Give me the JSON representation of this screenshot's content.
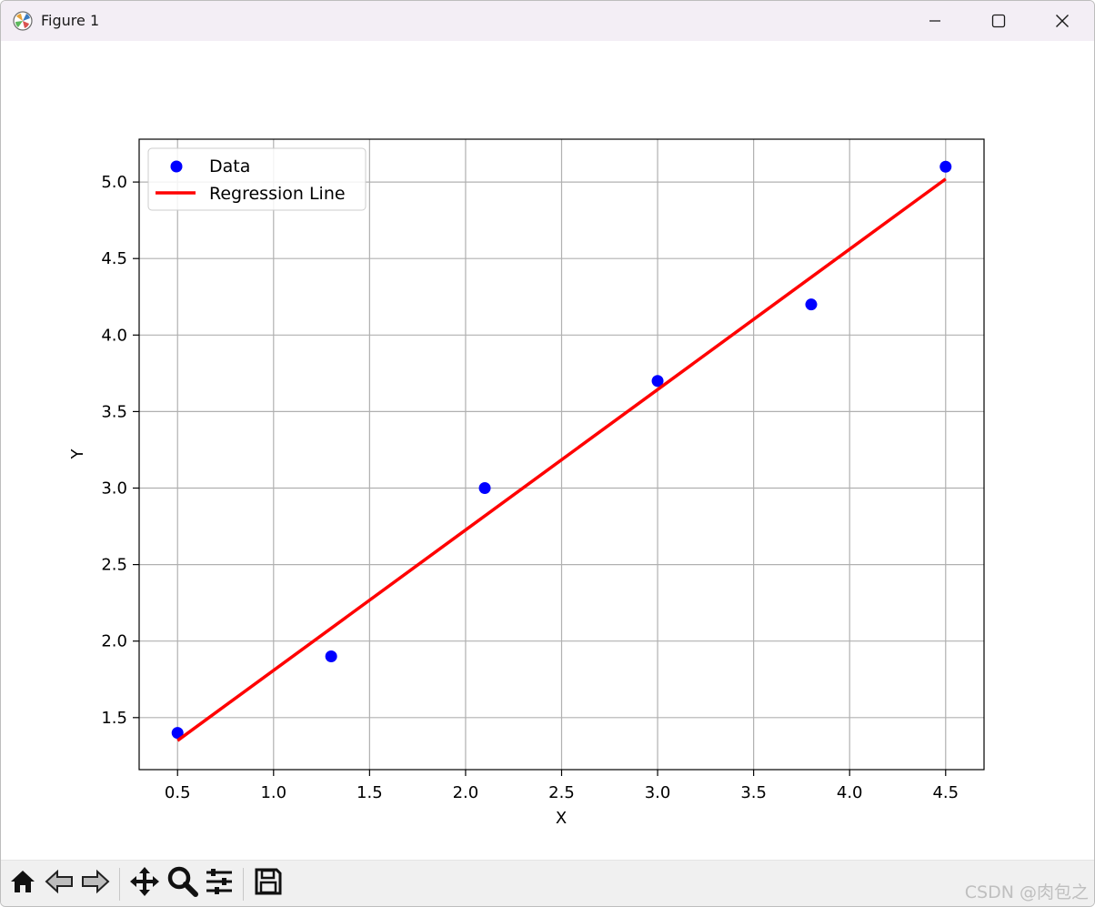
{
  "window": {
    "title": "Figure 1"
  },
  "icons": {
    "app": "matplotlib-logo-icon",
    "minimize": "minimize-icon",
    "maximize": "maximize-icon",
    "close": "close-icon",
    "home": "home-icon",
    "back": "back-arrow-icon",
    "forward": "forward-arrow-icon",
    "pan": "move-icon",
    "zoom": "zoom-icon",
    "configure": "sliders-icon",
    "save": "save-icon"
  },
  "watermark": "CSDN @肉包之",
  "chart_data": {
    "type": "scatter",
    "xlabel": "X",
    "ylabel": "Y",
    "xlim": [
      0.3,
      4.7
    ],
    "ylim": [
      1.16,
      5.28
    ],
    "x_ticks": [
      "0.5",
      "1.0",
      "1.5",
      "2.0",
      "2.5",
      "3.0",
      "3.5",
      "4.0",
      "4.5"
    ],
    "y_ticks": [
      "1.5",
      "2.0",
      "2.5",
      "3.0",
      "3.5",
      "4.0",
      "4.5",
      "5.0"
    ],
    "grid": true,
    "legend_position": "top-left",
    "series": [
      {
        "name": "Data",
        "kind": "scatter",
        "color": "#0000ff",
        "x": [
          0.5,
          1.3,
          2.1,
          3.0,
          3.8,
          4.5
        ],
        "y": [
          1.4,
          1.9,
          3.0,
          3.7,
          4.2,
          5.1
        ]
      },
      {
        "name": "Regression Line",
        "kind": "line",
        "color": "#ff0000",
        "x": [
          0.5,
          4.5
        ],
        "y": [
          1.35,
          5.02
        ]
      }
    ]
  }
}
